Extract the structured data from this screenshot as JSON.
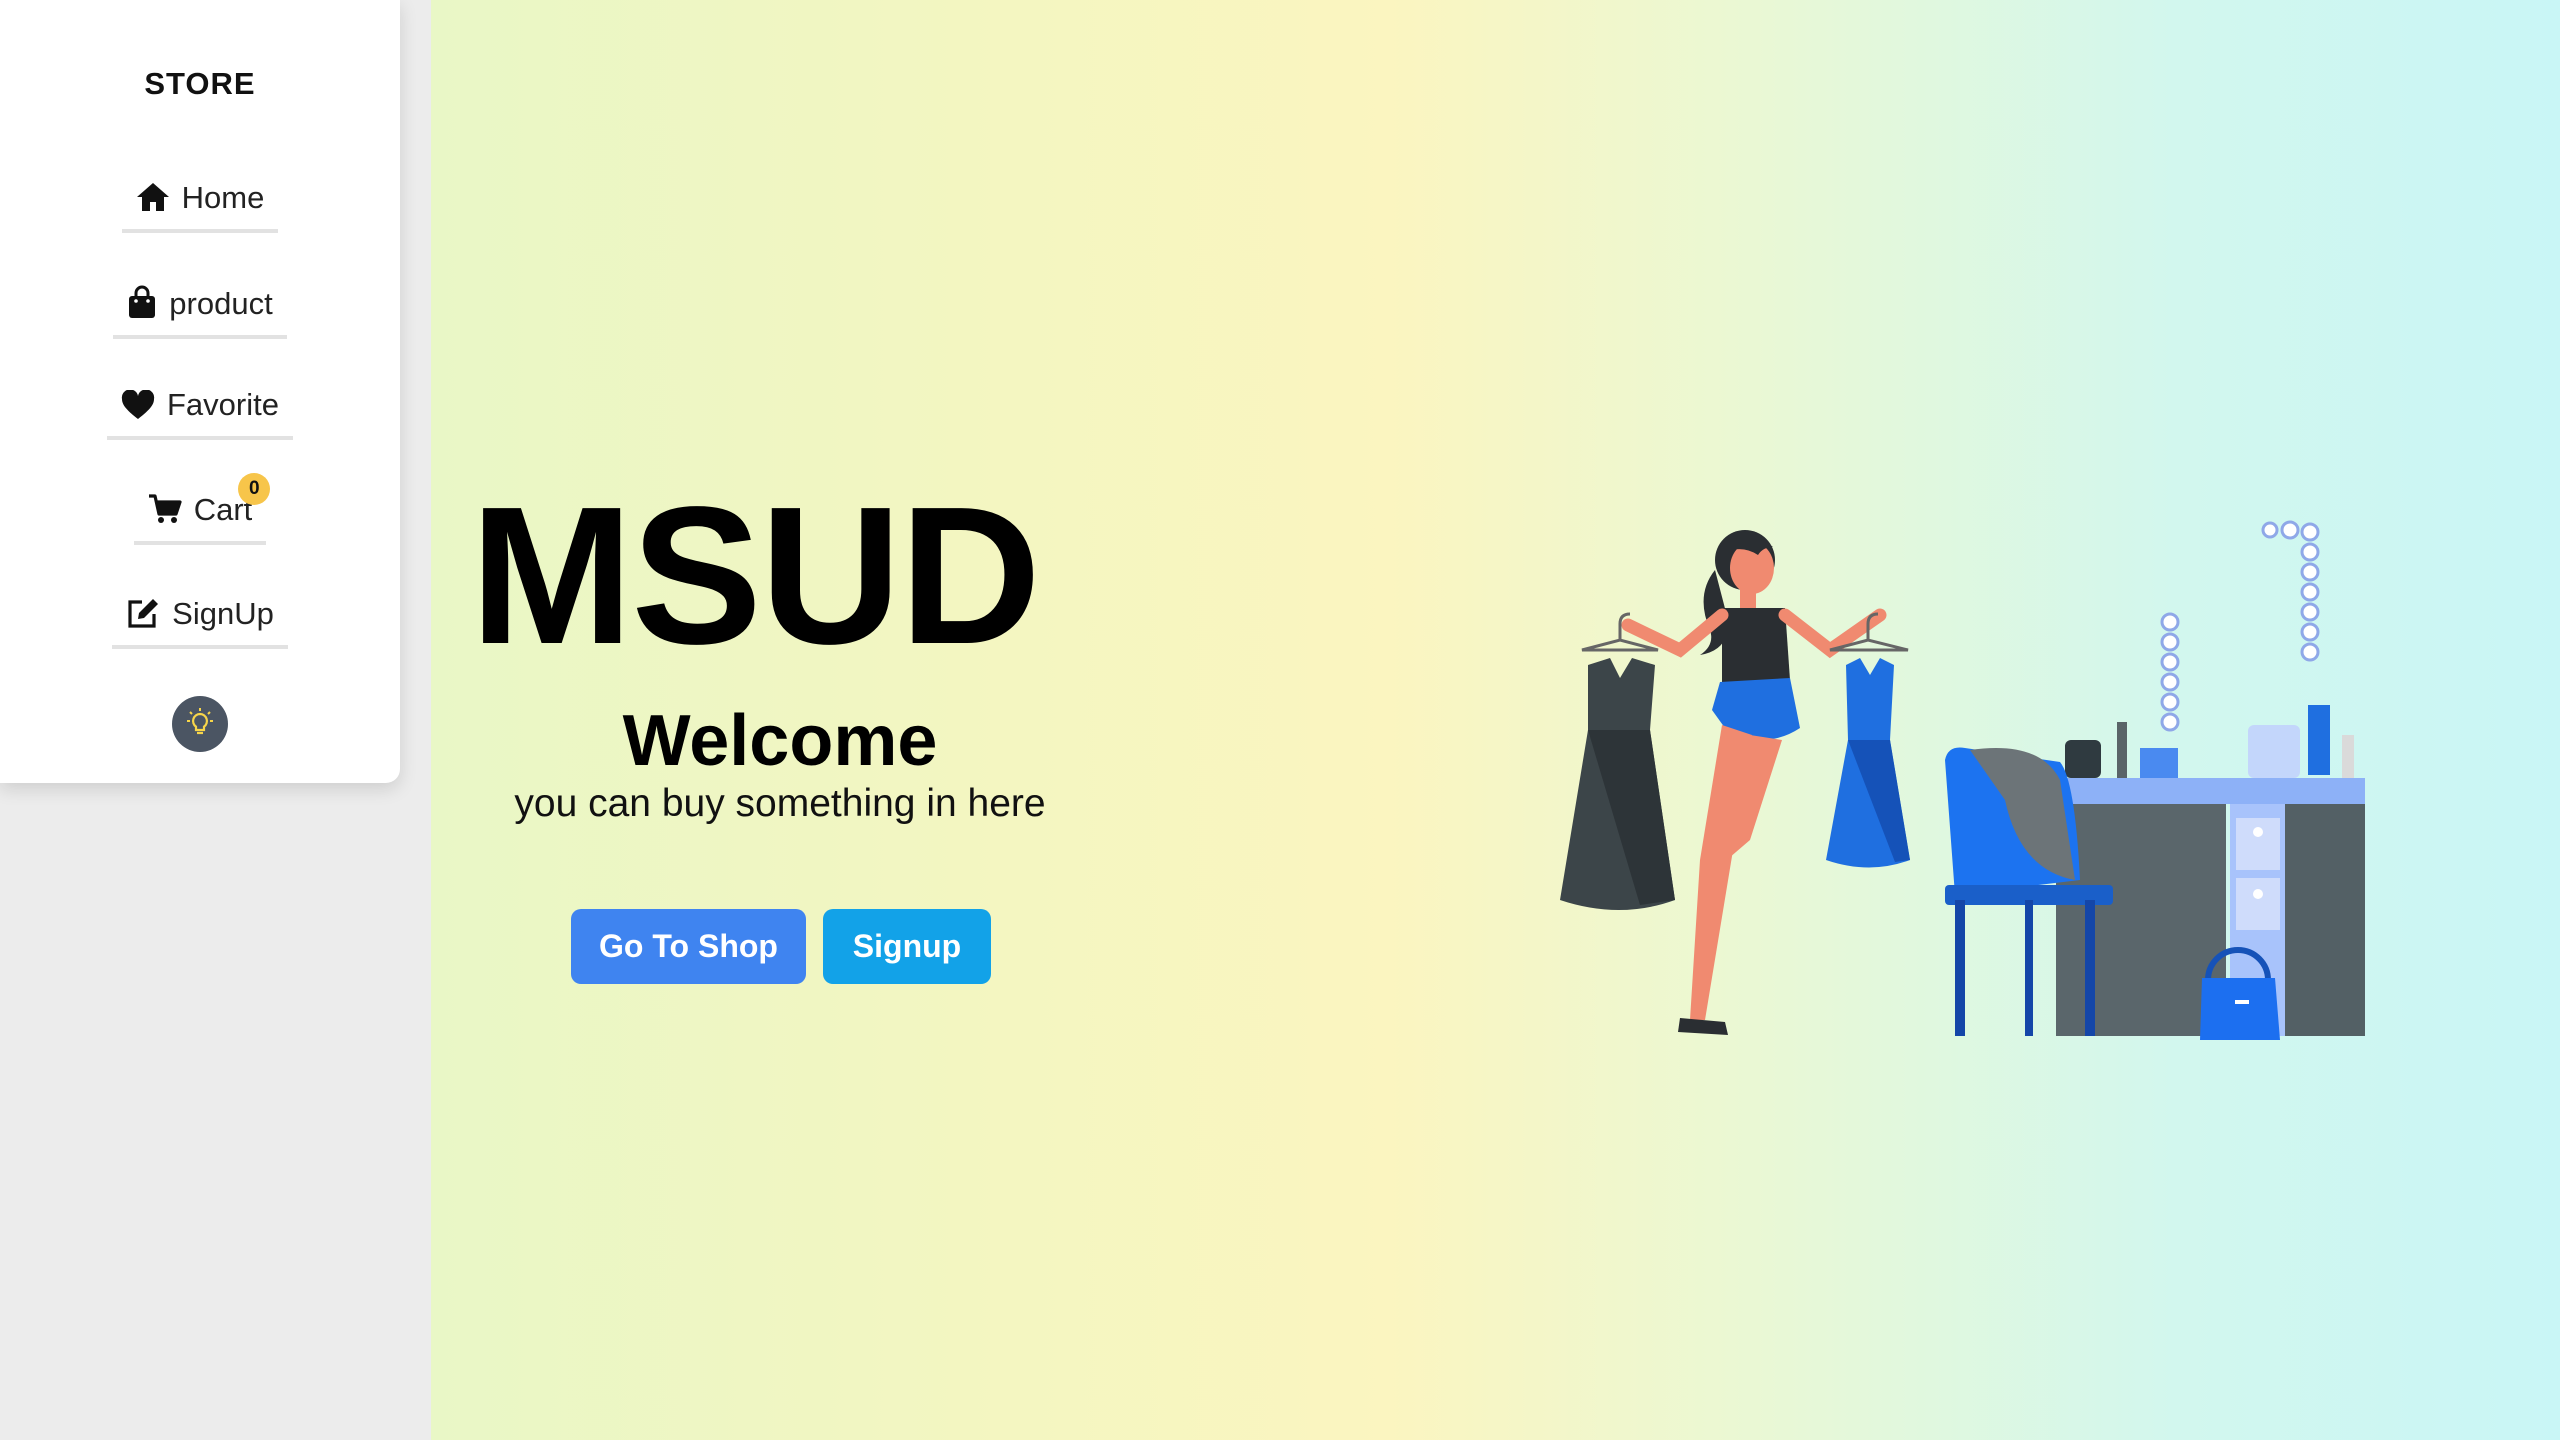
{
  "sidebar": {
    "brand": "STORE",
    "items": [
      {
        "label": "Home",
        "icon": "home-icon"
      },
      {
        "label": "product",
        "icon": "shopping-bag-icon"
      },
      {
        "label": "Favorite",
        "icon": "heart-icon"
      },
      {
        "label": "Cart",
        "icon": "cart-icon",
        "badge": "0"
      },
      {
        "label": "SignUp",
        "icon": "edit-icon"
      }
    ],
    "theme_toggle_icon": "lightbulb-icon"
  },
  "hero": {
    "title": "MSUD",
    "welcome": "Welcome",
    "tagline": "you can buy something in here",
    "buttons": {
      "shop": "Go To Shop",
      "signup": "Signup"
    },
    "illustration": "woman-holding-dresses-illustration"
  },
  "colors": {
    "primary_button": "#3f84f0",
    "secondary_button": "#12a2e8",
    "badge": "#f7c54a",
    "toggle_bg": "#4b5563"
  }
}
